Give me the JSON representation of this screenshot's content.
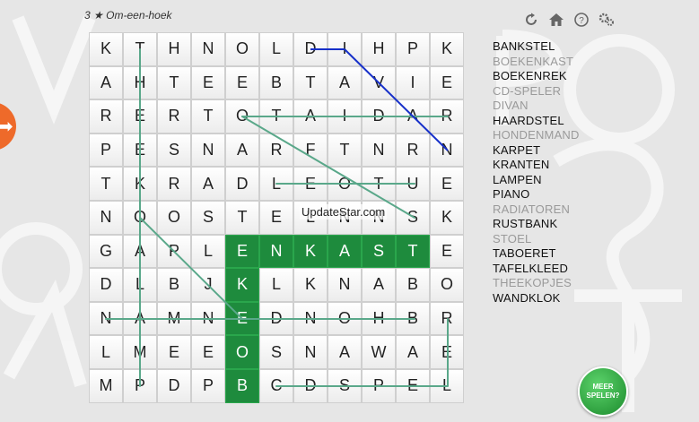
{
  "header": {
    "level": "3",
    "star": "★",
    "title": "Om-een-hoek"
  },
  "toolbar": {
    "icons": [
      "refresh-icon",
      "home-icon",
      "help-icon",
      "settings-icon"
    ]
  },
  "side_arrow": {
    "glyph": "➡"
  },
  "grid": {
    "rows": [
      [
        "K",
        "T",
        "H",
        "N",
        "O",
        "L",
        "D",
        "I",
        "H",
        "P",
        "K"
      ],
      [
        "A",
        "H",
        "T",
        "E",
        "E",
        "B",
        "T",
        "A",
        "V",
        "I",
        "E"
      ],
      [
        "R",
        "E",
        "R",
        "T",
        "O",
        "T",
        "A",
        "I",
        "D",
        "A",
        "R"
      ],
      [
        "P",
        "E",
        "S",
        "N",
        "A",
        "R",
        "F",
        "T",
        "N",
        "R",
        "N"
      ],
      [
        "T",
        "K",
        "R",
        "A",
        "D",
        "L",
        "E",
        "O",
        "T",
        "U",
        "E"
      ],
      [
        "N",
        "O",
        "O",
        "S",
        "T",
        "E",
        "L",
        "N",
        "N",
        "S",
        "K"
      ],
      [
        "G",
        "A",
        "P",
        "L",
        "E",
        "N",
        "K",
        "A",
        "S",
        "T",
        "E"
      ],
      [
        "D",
        "L",
        "B",
        "J",
        "K",
        "L",
        "K",
        "N",
        "A",
        "B",
        "O"
      ],
      [
        "N",
        "A",
        "M",
        "N",
        "E",
        "D",
        "N",
        "O",
        "H",
        "B",
        "R"
      ],
      [
        "L",
        "M",
        "E",
        "E",
        "O",
        "S",
        "N",
        "A",
        "W",
        "A",
        "E"
      ],
      [
        "M",
        "P",
        "D",
        "P",
        "B",
        "C",
        "D",
        "S",
        "P",
        "E",
        "L"
      ]
    ],
    "selected": [
      [
        6,
        4
      ],
      [
        6,
        5
      ],
      [
        6,
        6
      ],
      [
        6,
        7
      ],
      [
        6,
        8
      ],
      [
        6,
        9
      ],
      [
        7,
        4
      ],
      [
        8,
        4
      ],
      [
        9,
        4
      ],
      [
        10,
        4
      ]
    ]
  },
  "watermark": "UpdateStar.com",
  "words": [
    {
      "text": "BANKSTEL",
      "found": false
    },
    {
      "text": "BOEKENKAST",
      "found": true
    },
    {
      "text": "BOEKENREK",
      "found": false
    },
    {
      "text": "CD-SPELER",
      "found": true
    },
    {
      "text": "DIVAN",
      "found": true
    },
    {
      "text": "HAARDSTEL",
      "found": false
    },
    {
      "text": "HONDENMAND",
      "found": true
    },
    {
      "text": "KARPET",
      "found": false
    },
    {
      "text": "KRANTEN",
      "found": false
    },
    {
      "text": "LAMPEN",
      "found": false
    },
    {
      "text": "PIANO",
      "found": false
    },
    {
      "text": "RADIATOREN",
      "found": true
    },
    {
      "text": "RUSTBANK",
      "found": false
    },
    {
      "text": "STOEL",
      "found": true
    },
    {
      "text": "TABOERET",
      "found": false
    },
    {
      "text": "TAFELKLEED",
      "found": false
    },
    {
      "text": "THEEKOPJES",
      "found": true
    },
    {
      "text": "WANDKLOK",
      "found": false
    }
  ],
  "more_button": {
    "label": "MEER\nSPELEN?"
  },
  "colors": {
    "selected_cell": "#1e8b3d",
    "found_line": "#5aa88a",
    "current_line": "#1730c9",
    "found_word": "#9a9a9a"
  }
}
